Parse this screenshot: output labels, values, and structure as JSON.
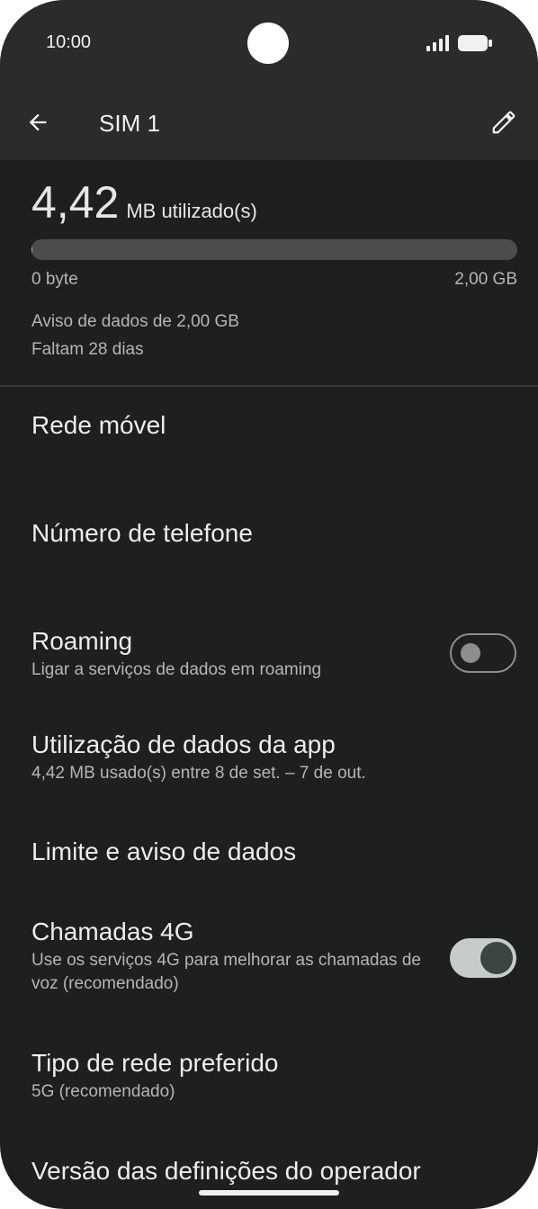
{
  "status_bar": {
    "time": "10:00",
    "icons": [
      "signal-icon",
      "battery-icon"
    ]
  },
  "app_bar": {
    "title": "SIM 1",
    "back_icon": "arrow-back-icon",
    "edit_icon": "pencil-icon"
  },
  "usage": {
    "value": "4,42",
    "unit": "MB utilizado(s)",
    "progress_fraction": 0.002,
    "range_min": "0 byte",
    "range_max": "2,00 GB",
    "warning": "Aviso de dados de 2,00 GB",
    "days_left": "Faltam 28 dias"
  },
  "preferences": [
    {
      "title": "Rede móvel",
      "summary": ""
    },
    {
      "title": "Número de telefone",
      "summary": ""
    },
    {
      "title": "Roaming",
      "summary": "Ligar a serviços de dados em roaming",
      "toggle": false
    },
    {
      "title": "Utilização de dados da app",
      "summary": "4,42 MB usado(s) entre 8 de set. – 7 de out."
    },
    {
      "title": "Limite e aviso de dados",
      "summary": ""
    },
    {
      "title": "Chamadas 4G",
      "summary": "Use os serviços 4G para melhorar as chamadas de voz (recomendado)",
      "toggle": true
    },
    {
      "title": "Tipo de rede preferido",
      "summary": "5G (recomendado)"
    },
    {
      "title": "Versão das definições do operador",
      "summary": ""
    }
  ],
  "colors": {
    "background": "#1e1f1f",
    "app_bar": "#2a2b2b",
    "toggle_on_track": "#c6ccc9",
    "toggle_on_knob": "#3b4541"
  }
}
